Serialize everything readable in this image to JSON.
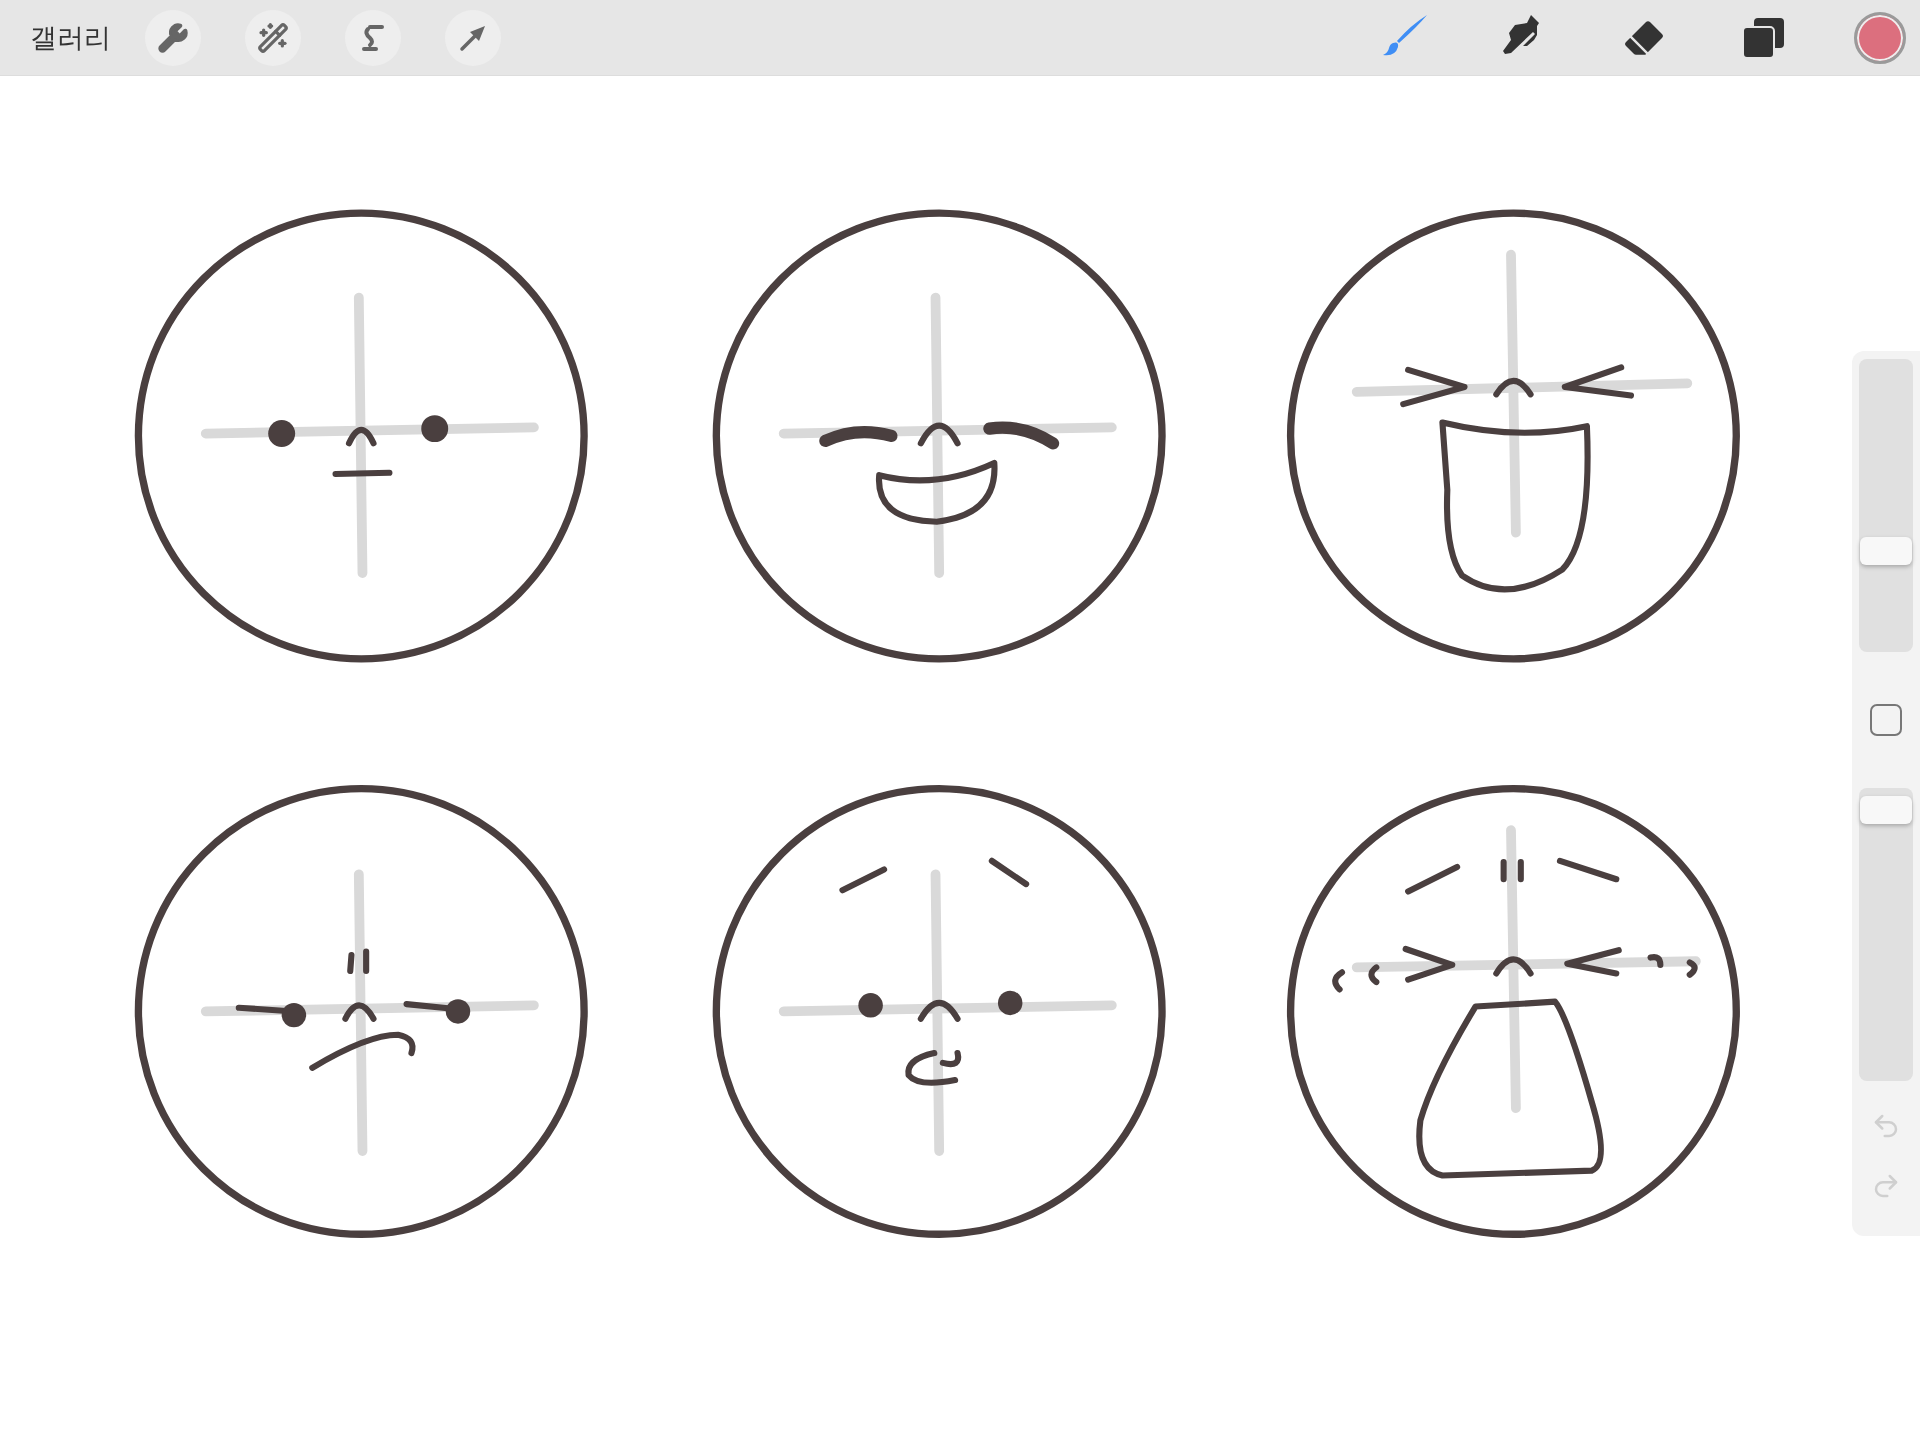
{
  "toolbar": {
    "gallery_label": "갤러리",
    "actions": [
      {
        "kind": "wrench"
      },
      {
        "kind": "wand"
      },
      {
        "kind": "selection"
      },
      {
        "kind": "transform"
      }
    ],
    "tools": [
      {
        "kind": "brush",
        "selected": true
      },
      {
        "kind": "smudge",
        "selected": false
      },
      {
        "kind": "eraser",
        "selected": false
      }
    ],
    "color_swatch": {
      "color": "#dc6f7e"
    }
  },
  "sidebar": {
    "size_slider": {
      "level": 0.33
    },
    "opacity_slider": {
      "level": 0.97
    }
  }
}
